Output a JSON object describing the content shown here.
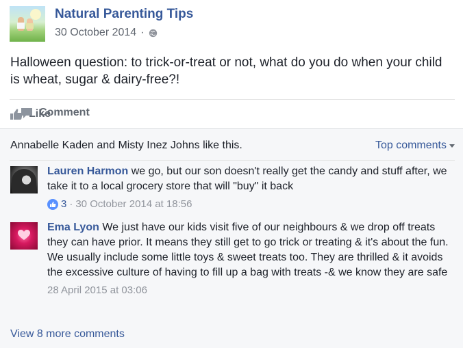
{
  "post": {
    "page_name": "Natural Parenting Tips",
    "date": "30 October 2014",
    "separator": "·",
    "privacy_icon": "globe-icon",
    "text": "Halloween question: to trick-or-treat or not, what do you do when your child is wheat, sugar & dairy-free?!"
  },
  "actions": {
    "like_label": "Like",
    "comment_label": "Comment"
  },
  "comments_section": {
    "likes_summary": "Annabelle Kaden and Misty Inez Johns like this.",
    "sort_label": "Top comments",
    "comments": [
      {
        "author": "Lauren Harmon",
        "text": "we go, but our son doesn't really get the candy and stuff after, we take it to a local grocery store that will \"buy\" it back",
        "like_count": "3",
        "separator": "·",
        "timestamp": "30 October 2014 at 18:56"
      },
      {
        "author": "Ema Lyon",
        "text": "We just have our kids visit five of our neighbours & we drop off treats they can have prior. It means they still get to go trick or treating & it's about the fun. We usually include some little toys & sweet treats too. They are thrilled & it avoids the excessive culture of having to fill up a bag with treats -& we know they are safe",
        "timestamp": "28 April 2015 at 03:06"
      }
    ],
    "view_more": "View 8 more comments"
  },
  "colors": {
    "link": "#365899",
    "meta": "#90949c",
    "background": "#f6f7f9",
    "like_badge": "#5890ff"
  }
}
